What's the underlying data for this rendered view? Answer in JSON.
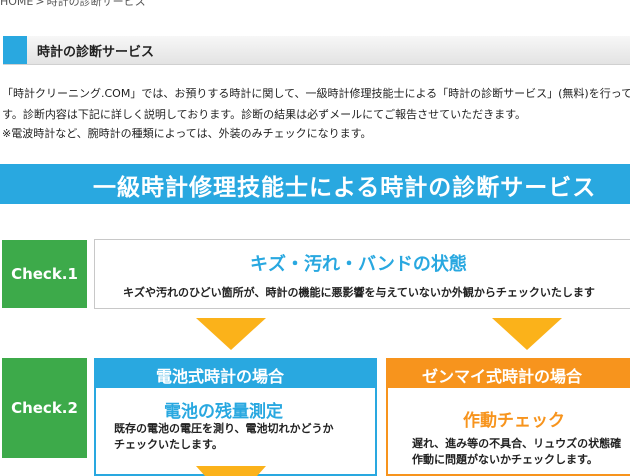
{
  "breadcrumb": {
    "home": "HOME",
    "separator": ">",
    "current": "時計の診断サービス"
  },
  "page_title": "時計の診断サービス",
  "intro": {
    "line1": "「時計クリーニング.COM」では、お預りする時計に関して、一級時計修理技能士による「時計の診断サービス」(無料)を行ってお",
    "line2": "す。診断内容は下記に詳しく説明しております。診断の結果は必ずメールにてご報告させていただきます。",
    "line3": "※電波時計など、腕時計の種類によっては、外装のみチェックになります。"
  },
  "banner": {
    "text": "一級時計修理技能士による時計の診断サービス"
  },
  "check1": {
    "label": "Check.1",
    "heading": "キズ・汚れ・バンドの状態",
    "description": "キズや汚れのひどい箇所が、時計の機能に悪影響を与えていないか外観からチェックいたします"
  },
  "check2": {
    "label": "Check.2",
    "battery": {
      "header": "電池式時計の場合",
      "subheading": "電池の残量測定",
      "body_line1": "既存の電池の電圧を測り、電池切れかどうか",
      "body_line2": "チェックいたします。"
    },
    "mechanical": {
      "header": "ゼンマイ式時計の場合",
      "subheading": "作動チェック",
      "body_line1": "遅れ、進み等の不具合、リュウズの状態確",
      "body_line2": "作動に問題がないかチェックします。"
    }
  },
  "colors": {
    "accent_blue": "#29a8e0",
    "check_green": "#3daa4a",
    "arrow_yellow": "#fbb21a",
    "accent_orange": "#f7941d"
  }
}
